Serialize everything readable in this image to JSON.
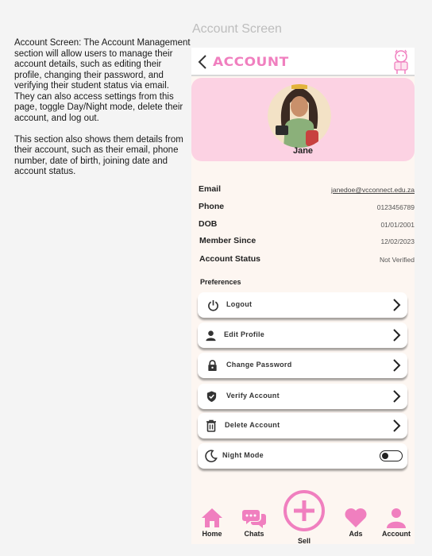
{
  "frame_title": "Account Screen",
  "description": {
    "para1": "Account Screen: The Account Management section will allow users to manage their account details, such as editing their profile, changing their password, and verifying their student status via email. They can also access settings from this page, toggle Day/Night mode, delete their account, and log out.",
    "para2": "This section also shows them details from their account, such as their email, phone number, date of birth, joining date and account status."
  },
  "header": {
    "title": "ACCOUNT",
    "back_icon": "chevron-left-icon",
    "mascot_icon": "reading-mascot-icon"
  },
  "profile": {
    "name": "Jane"
  },
  "details": [
    {
      "label": "Email",
      "value": "janedoe@vcconnect.edu.za"
    },
    {
      "label": "Phone",
      "value": "0123456789"
    },
    {
      "label": "DOB",
      "value": "01/01/2001"
    },
    {
      "label": "Member Since",
      "value": "12/02/2023"
    },
    {
      "label": "Account Status",
      "value": "Not Verified"
    }
  ],
  "preferences": {
    "heading": "Preferences",
    "items": [
      {
        "label": "Logout",
        "icon": "power-icon"
      },
      {
        "label": "Edit Profile",
        "icon": "person-icon"
      },
      {
        "label": "Change Password",
        "icon": "lock-icon"
      },
      {
        "label": "Verify Account",
        "icon": "shield-check-icon"
      },
      {
        "label": "Delete Account",
        "icon": "trash-icon"
      },
      {
        "label": "Night Mode",
        "icon": "moon-icon",
        "toggle": false
      }
    ]
  },
  "nav": {
    "home": "Home",
    "chats": "Chats",
    "sell": "Sell",
    "ads": "Ads",
    "account": "Account"
  },
  "colors": {
    "accent": "#f07fbf",
    "profile_bg": "#fcd2e3",
    "screen_bg": "#fdf6f1"
  }
}
